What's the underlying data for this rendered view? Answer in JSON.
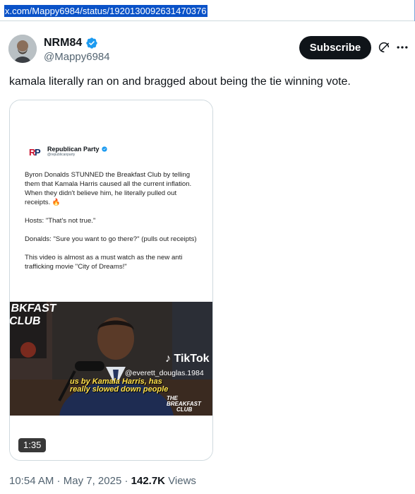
{
  "browser": {
    "url": "x.com/Mappy6984/status/1920130092631470376"
  },
  "author": {
    "name": "NRM84",
    "handle": "@Mappy6984"
  },
  "actions": {
    "subscribe_label": "Subscribe"
  },
  "tweet": {
    "text": "kamala literally ran on and bragged about being the tie winning vote."
  },
  "embedded_post": {
    "account_name": "Republican Party",
    "account_handle": "@republicanparty",
    "paragraphs": [
      "Byron Donalds STUNNED the Breakfast Club by telling them that Kamala Harris caused all the current inflation. When they didn't believe him, he literally pulled out receipts. 🔥",
      "Hosts: \"That's not true.\"",
      "Donalds: \"Sure you want to go there?\" (pulls out receipts)",
      "This video is almost as a must watch as the new anti trafficking movie \"City of Dreams!\""
    ]
  },
  "video": {
    "station_text": "BREAKFAST CLUB",
    "tiktok_label": "TikTok",
    "tiktok_handle": "@everett_douglas.1984",
    "caption_line1": "us by Kamala Harris, has",
    "caption_line2": "really slowed down people",
    "watermark_line1": "THE BREAKFAST",
    "watermark_line2": "CLUB",
    "duration": "1:35"
  },
  "meta": {
    "time": "10:54 AM",
    "sep1": " · ",
    "date": "May 7, 2025",
    "sep2": " · ",
    "views_count": "142.7K",
    "views_label": "Views"
  },
  "colors": {
    "accent_blue": "#1d9bf0",
    "text_primary": "#0f1419",
    "text_secondary": "#536471",
    "border": "#cfd9de"
  }
}
